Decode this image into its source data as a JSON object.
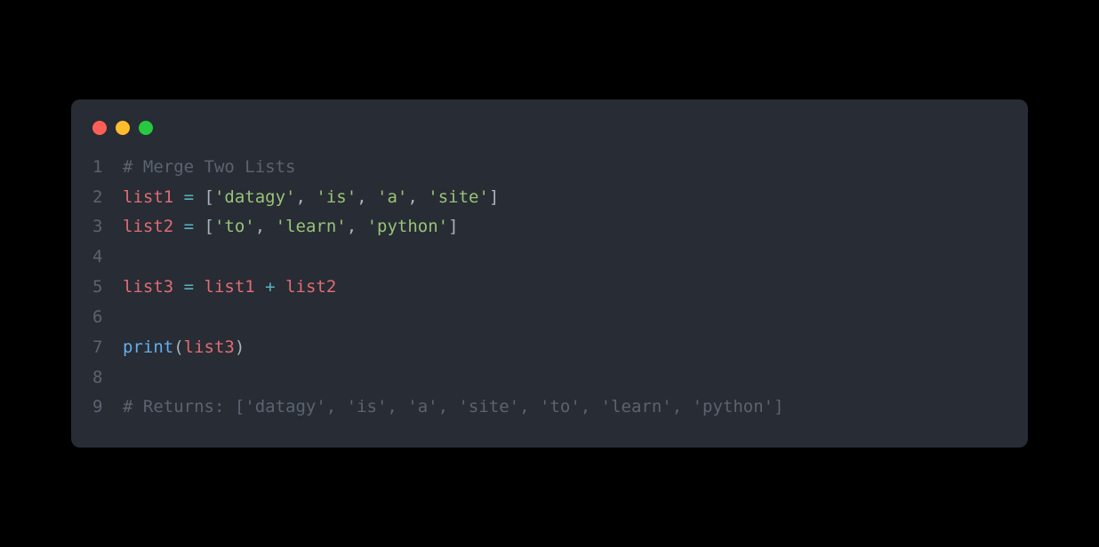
{
  "window": {
    "traffic_lights": [
      "red",
      "yellow",
      "green"
    ]
  },
  "code": {
    "line_numbers": [
      "1",
      "2",
      "3",
      "4",
      "5",
      "6",
      "7",
      "8",
      "9"
    ],
    "tokens": {
      "l1_comment": "# Merge Two Lists",
      "l2_var": "list1",
      "l2_eq": " = ",
      "l2_b1": "[",
      "l2_s1": "'datagy'",
      "l2_c1": ", ",
      "l2_s2": "'is'",
      "l2_c2": ", ",
      "l2_s3": "'a'",
      "l2_c3": ", ",
      "l2_s4": "'site'",
      "l2_b2": "]",
      "l3_var": "list2",
      "l3_eq": " = ",
      "l3_b1": "[",
      "l3_s1": "'to'",
      "l3_c1": ", ",
      "l3_s2": "'learn'",
      "l3_c2": ", ",
      "l3_s3": "'python'",
      "l3_b2": "]",
      "l5_var": "list3",
      "l5_eq": " = ",
      "l5_v1": "list1",
      "l5_plus": " + ",
      "l5_v2": "list2",
      "l7_fn": "print",
      "l7_p1": "(",
      "l7_arg": "list3",
      "l7_p2": ")",
      "l9_comment": "# Returns: ['datagy', 'is', 'a', 'site', 'to', 'learn', 'python']"
    }
  }
}
